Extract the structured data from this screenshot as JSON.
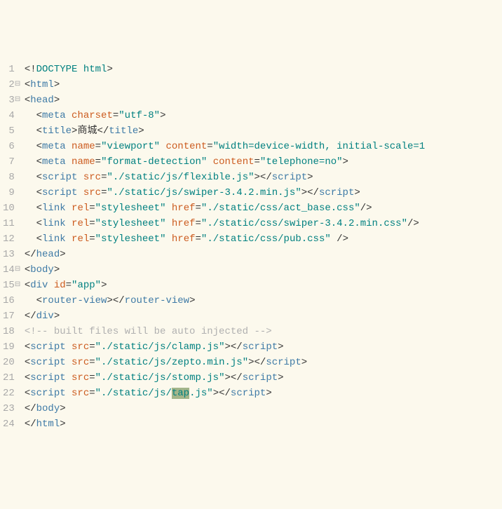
{
  "lines": [
    {
      "num": 1,
      "fold": "",
      "segs": [
        {
          "t": "<!",
          "c": "bracket"
        },
        {
          "t": "DOCTYPE html",
          "c": "decl"
        },
        {
          "t": ">",
          "c": "bracket"
        }
      ]
    },
    {
      "num": 2,
      "fold": "⊟",
      "segs": [
        {
          "t": "<",
          "c": "bracket"
        },
        {
          "t": "html",
          "c": "tag"
        },
        {
          "t": ">",
          "c": "bracket"
        }
      ]
    },
    {
      "num": 3,
      "fold": "⊟",
      "segs": [
        {
          "t": "<",
          "c": "bracket"
        },
        {
          "t": "head",
          "c": "tag"
        },
        {
          "t": ">",
          "c": "bracket"
        }
      ]
    },
    {
      "num": 4,
      "fold": "",
      "segs": [
        {
          "t": "  ",
          "c": "text"
        },
        {
          "t": "<",
          "c": "bracket"
        },
        {
          "t": "meta ",
          "c": "tag"
        },
        {
          "t": "charset",
          "c": "attr"
        },
        {
          "t": "=",
          "c": "eq"
        },
        {
          "t": "\"utf-8\"",
          "c": "str"
        },
        {
          "t": ">",
          "c": "bracket"
        }
      ]
    },
    {
      "num": 5,
      "fold": "",
      "segs": [
        {
          "t": "  ",
          "c": "text"
        },
        {
          "t": "<",
          "c": "bracket"
        },
        {
          "t": "title",
          "c": "tag"
        },
        {
          "t": ">",
          "c": "bracket"
        },
        {
          "t": "商城",
          "c": "text"
        },
        {
          "t": "</",
          "c": "bracket"
        },
        {
          "t": "title",
          "c": "tag"
        },
        {
          "t": ">",
          "c": "bracket"
        }
      ]
    },
    {
      "num": 6,
      "fold": "",
      "segs": [
        {
          "t": "  ",
          "c": "text"
        },
        {
          "t": "<",
          "c": "bracket"
        },
        {
          "t": "meta ",
          "c": "tag"
        },
        {
          "t": "name",
          "c": "attr"
        },
        {
          "t": "=",
          "c": "eq"
        },
        {
          "t": "\"viewport\"",
          "c": "str"
        },
        {
          "t": " ",
          "c": "text"
        },
        {
          "t": "content",
          "c": "attr"
        },
        {
          "t": "=",
          "c": "eq"
        },
        {
          "t": "\"width=device-width, initial-scale=1",
          "c": "str"
        }
      ]
    },
    {
      "num": 7,
      "fold": "",
      "segs": [
        {
          "t": "  ",
          "c": "text"
        },
        {
          "t": "<",
          "c": "bracket"
        },
        {
          "t": "meta ",
          "c": "tag"
        },
        {
          "t": "name",
          "c": "attr"
        },
        {
          "t": "=",
          "c": "eq"
        },
        {
          "t": "\"format-detection\"",
          "c": "str"
        },
        {
          "t": " ",
          "c": "text"
        },
        {
          "t": "content",
          "c": "attr"
        },
        {
          "t": "=",
          "c": "eq"
        },
        {
          "t": "\"telephone=no\"",
          "c": "str"
        },
        {
          "t": ">",
          "c": "bracket"
        }
      ]
    },
    {
      "num": 8,
      "fold": "",
      "segs": [
        {
          "t": "  ",
          "c": "text"
        },
        {
          "t": "<",
          "c": "bracket"
        },
        {
          "t": "script ",
          "c": "tag"
        },
        {
          "t": "src",
          "c": "attr"
        },
        {
          "t": "=",
          "c": "eq"
        },
        {
          "t": "\"./static/js/flexible.js\"",
          "c": "str"
        },
        {
          "t": "></",
          "c": "bracket"
        },
        {
          "t": "script",
          "c": "tag"
        },
        {
          "t": ">",
          "c": "bracket"
        }
      ]
    },
    {
      "num": 9,
      "fold": "",
      "segs": [
        {
          "t": "  ",
          "c": "text"
        },
        {
          "t": "<",
          "c": "bracket"
        },
        {
          "t": "script ",
          "c": "tag"
        },
        {
          "t": "src",
          "c": "attr"
        },
        {
          "t": "=",
          "c": "eq"
        },
        {
          "t": "\"./static/js/swiper-3.4.2.min.js\"",
          "c": "str"
        },
        {
          "t": "></",
          "c": "bracket"
        },
        {
          "t": "script",
          "c": "tag"
        },
        {
          "t": ">",
          "c": "bracket"
        }
      ]
    },
    {
      "num": 10,
      "fold": "",
      "segs": [
        {
          "t": "  ",
          "c": "text"
        },
        {
          "t": "<",
          "c": "bracket"
        },
        {
          "t": "link ",
          "c": "tag"
        },
        {
          "t": "rel",
          "c": "attr"
        },
        {
          "t": "=",
          "c": "eq"
        },
        {
          "t": "\"stylesheet\"",
          "c": "str"
        },
        {
          "t": " ",
          "c": "text"
        },
        {
          "t": "href",
          "c": "attr"
        },
        {
          "t": "=",
          "c": "eq"
        },
        {
          "t": "\"./static/css/act_base.css\"",
          "c": "str"
        },
        {
          "t": "/>",
          "c": "bracket"
        }
      ]
    },
    {
      "num": 11,
      "fold": "",
      "segs": [
        {
          "t": "  ",
          "c": "text"
        },
        {
          "t": "<",
          "c": "bracket"
        },
        {
          "t": "link ",
          "c": "tag"
        },
        {
          "t": "rel",
          "c": "attr"
        },
        {
          "t": "=",
          "c": "eq"
        },
        {
          "t": "\"stylesheet\"",
          "c": "str"
        },
        {
          "t": " ",
          "c": "text"
        },
        {
          "t": "href",
          "c": "attr"
        },
        {
          "t": "=",
          "c": "eq"
        },
        {
          "t": "\"./static/css/swiper-3.4.2.min.css\"",
          "c": "str"
        },
        {
          "t": "/>",
          "c": "bracket"
        }
      ]
    },
    {
      "num": 12,
      "fold": "",
      "segs": [
        {
          "t": "  ",
          "c": "text"
        },
        {
          "t": "<",
          "c": "bracket"
        },
        {
          "t": "link ",
          "c": "tag"
        },
        {
          "t": "rel",
          "c": "attr"
        },
        {
          "t": "=",
          "c": "eq"
        },
        {
          "t": "\"stylesheet\"",
          "c": "str"
        },
        {
          "t": " ",
          "c": "text"
        },
        {
          "t": "href",
          "c": "attr"
        },
        {
          "t": "=",
          "c": "eq"
        },
        {
          "t": "\"./static/css/pub.css\"",
          "c": "str"
        },
        {
          "t": " />",
          "c": "bracket"
        }
      ]
    },
    {
      "num": 13,
      "fold": "",
      "segs": [
        {
          "t": "</",
          "c": "bracket"
        },
        {
          "t": "head",
          "c": "tag"
        },
        {
          "t": ">",
          "c": "bracket"
        }
      ]
    },
    {
      "num": 14,
      "fold": "⊟",
      "segs": [
        {
          "t": "<",
          "c": "bracket"
        },
        {
          "t": "body",
          "c": "tag"
        },
        {
          "t": ">",
          "c": "bracket"
        }
      ]
    },
    {
      "num": 15,
      "fold": "⊟",
      "segs": [
        {
          "t": "<",
          "c": "bracket"
        },
        {
          "t": "div ",
          "c": "tag"
        },
        {
          "t": "id",
          "c": "attr"
        },
        {
          "t": "=",
          "c": "eq"
        },
        {
          "t": "\"app\"",
          "c": "str"
        },
        {
          "t": ">",
          "c": "bracket"
        }
      ]
    },
    {
      "num": 16,
      "fold": "",
      "segs": [
        {
          "t": "  ",
          "c": "text"
        },
        {
          "t": "<",
          "c": "bracket"
        },
        {
          "t": "router-view",
          "c": "tag"
        },
        {
          "t": "></",
          "c": "bracket"
        },
        {
          "t": "router-view",
          "c": "tag"
        },
        {
          "t": ">",
          "c": "bracket"
        }
      ]
    },
    {
      "num": 17,
      "fold": "",
      "segs": [
        {
          "t": "</",
          "c": "bracket"
        },
        {
          "t": "div",
          "c": "tag"
        },
        {
          "t": ">",
          "c": "bracket"
        }
      ]
    },
    {
      "num": 18,
      "fold": "",
      "segs": [
        {
          "t": "<!-- built files will be auto injected -->",
          "c": "comment"
        }
      ]
    },
    {
      "num": 19,
      "fold": "",
      "segs": [
        {
          "t": "<",
          "c": "bracket"
        },
        {
          "t": "script ",
          "c": "tag"
        },
        {
          "t": "src",
          "c": "attr"
        },
        {
          "t": "=",
          "c": "eq"
        },
        {
          "t": "\"./static/js/clamp.js\"",
          "c": "str"
        },
        {
          "t": "></",
          "c": "bracket"
        },
        {
          "t": "script",
          "c": "tag"
        },
        {
          "t": ">",
          "c": "bracket"
        }
      ]
    },
    {
      "num": 20,
      "fold": "",
      "segs": [
        {
          "t": "<",
          "c": "bracket"
        },
        {
          "t": "script ",
          "c": "tag"
        },
        {
          "t": "src",
          "c": "attr"
        },
        {
          "t": "=",
          "c": "eq"
        },
        {
          "t": "\"./static/js/zepto.min.js\"",
          "c": "str"
        },
        {
          "t": "></",
          "c": "bracket"
        },
        {
          "t": "script",
          "c": "tag"
        },
        {
          "t": ">",
          "c": "bracket"
        }
      ]
    },
    {
      "num": 21,
      "fold": "",
      "segs": [
        {
          "t": "<",
          "c": "bracket"
        },
        {
          "t": "script ",
          "c": "tag"
        },
        {
          "t": "src",
          "c": "attr"
        },
        {
          "t": "=",
          "c": "eq"
        },
        {
          "t": "\"./static/js/stomp.js\"",
          "c": "str"
        },
        {
          "t": "></",
          "c": "bracket"
        },
        {
          "t": "script",
          "c": "tag"
        },
        {
          "t": ">",
          "c": "bracket"
        }
      ]
    },
    {
      "num": 22,
      "fold": "",
      "segs": [
        {
          "t": "<",
          "c": "bracket"
        },
        {
          "t": "script ",
          "c": "tag"
        },
        {
          "t": "src",
          "c": "attr"
        },
        {
          "t": "=",
          "c": "eq"
        },
        {
          "t": "\"./static/js/",
          "c": "str"
        },
        {
          "t": "tap",
          "c": "str hl"
        },
        {
          "t": ".js\"",
          "c": "str"
        },
        {
          "t": "></",
          "c": "bracket"
        },
        {
          "t": "script",
          "c": "tag"
        },
        {
          "t": ">",
          "c": "bracket"
        }
      ]
    },
    {
      "num": 23,
      "fold": "",
      "segs": [
        {
          "t": "</",
          "c": "bracket"
        },
        {
          "t": "body",
          "c": "tag"
        },
        {
          "t": ">",
          "c": "bracket"
        }
      ]
    },
    {
      "num": 24,
      "fold": "",
      "segs": [
        {
          "t": "</",
          "c": "bracket"
        },
        {
          "t": "html",
          "c": "tag"
        },
        {
          "t": ">",
          "c": "bracket"
        }
      ]
    }
  ]
}
